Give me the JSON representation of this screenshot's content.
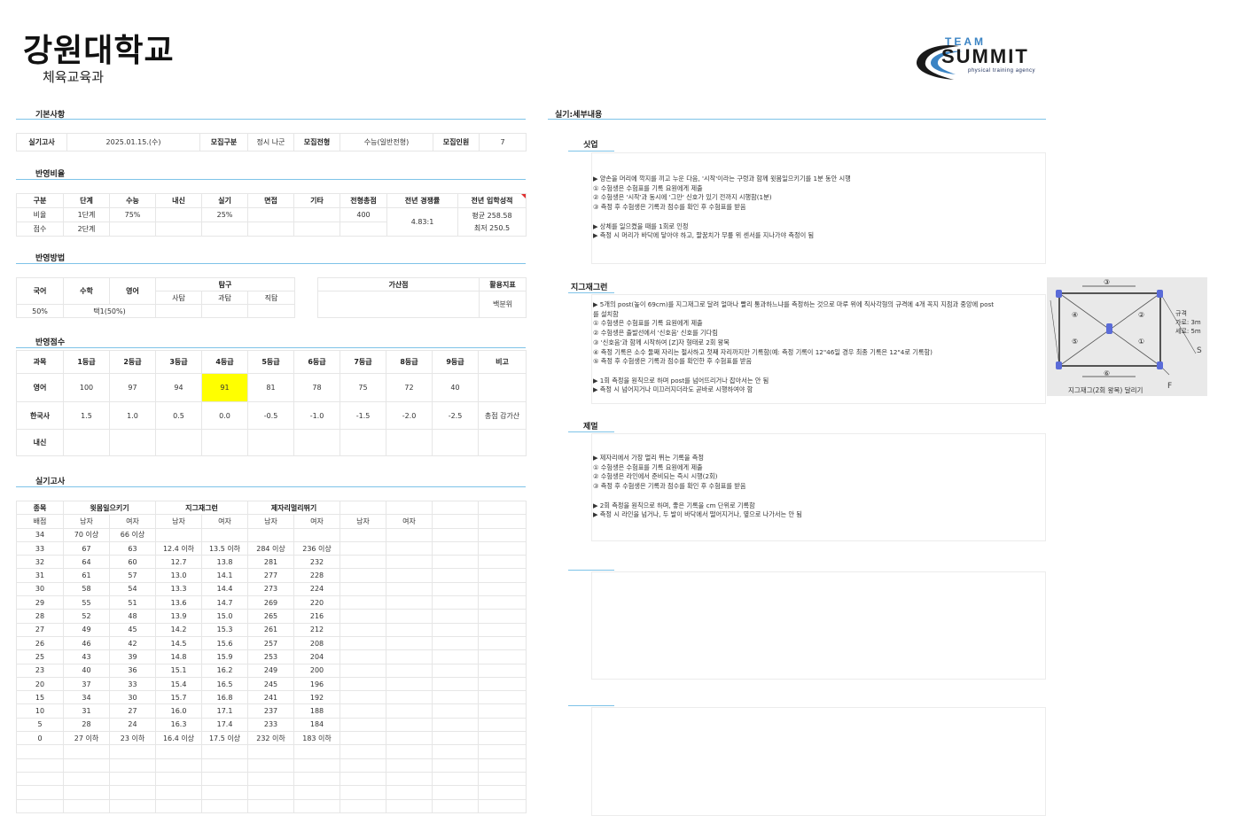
{
  "header": {
    "university": "강원대학교",
    "department": "체육교육과"
  },
  "logo": {
    "team": "TEAM",
    "summit": "SUMMIT",
    "tagline": "physical training agency"
  },
  "sections": {
    "basic": "기본사항",
    "ratio": "반영비율",
    "method": "반영방법",
    "score": "반영점수",
    "practical": "실기고사",
    "practical_detail": "실기:세부내용"
  },
  "basic": {
    "exam_label": "실기고사",
    "exam_date": "2025.01.15.(수)",
    "group_label": "모집구분",
    "group_value": "정시 나군",
    "type_label": "모집전형",
    "type_value": "수능(일반전형)",
    "quota_label": "모집인원",
    "quota_value": "7"
  },
  "ratio": {
    "headers": [
      "구분",
      "단계",
      "수능",
      "내신",
      "실기",
      "면접",
      "기타",
      "전형총점",
      "전년 경쟁률",
      "전년 입학성적"
    ],
    "row1": [
      "비율",
      "1단계",
      "75%",
      "",
      "25%",
      "",
      "",
      "400"
    ],
    "row2": [
      "점수",
      "2단계",
      "",
      "",
      "",
      "",
      "",
      ""
    ],
    "competition": "4.83:1",
    "admission_avg": "평균 258.58",
    "admission_min": "최저 250.5"
  },
  "method": {
    "korean": "국어",
    "math": "수학",
    "english": "영어",
    "inquiry": "탐구",
    "society": "사탐",
    "science": "과탐",
    "vocational": "직탐",
    "korean_value": "50%",
    "choice_value": "택1(50%)",
    "bonus": "가산점",
    "index": "활용지표",
    "index_value": "백분위"
  },
  "score": {
    "headers": [
      "과목",
      "1등급",
      "2등급",
      "3등급",
      "4등급",
      "5등급",
      "6등급",
      "7등급",
      "8등급",
      "9등급",
      "비고"
    ],
    "english": [
      "영어",
      "100",
      "97",
      "94",
      "91",
      "81",
      "78",
      "75",
      "72",
      "40",
      ""
    ],
    "history": [
      "한국사",
      "1.5",
      "1.0",
      "0.5",
      "0.0",
      "-0.5",
      "-1.0",
      "-1.5",
      "-2.0",
      "-2.5",
      "총점 감가산"
    ],
    "naesin": [
      "내신",
      "",
      "",
      "",
      "",
      "",
      "",
      "",
      "",
      "",
      ""
    ],
    "highlight_color": "#ffff00"
  },
  "practical": {
    "h1": [
      "종목",
      "윗몸일으키기",
      "지그재그런",
      "제자리멀리뛰기"
    ],
    "h2": [
      "배점",
      "남자",
      "여자",
      "남자",
      "여자",
      "남자",
      "여자",
      "남자",
      "여자"
    ],
    "rows": [
      [
        "34",
        "70 이상",
        "66 이상",
        "",
        "",
        "",
        ""
      ],
      [
        "33",
        "67",
        "63",
        "12.4 이하",
        "13.5 이하",
        "284 이상",
        "236 이상"
      ],
      [
        "32",
        "64",
        "60",
        "12.7",
        "13.8",
        "281",
        "232"
      ],
      [
        "31",
        "61",
        "57",
        "13.0",
        "14.1",
        "277",
        "228"
      ],
      [
        "30",
        "58",
        "54",
        "13.3",
        "14.4",
        "273",
        "224"
      ],
      [
        "29",
        "55",
        "51",
        "13.6",
        "14.7",
        "269",
        "220"
      ],
      [
        "28",
        "52",
        "48",
        "13.9",
        "15.0",
        "265",
        "216"
      ],
      [
        "27",
        "49",
        "45",
        "14.2",
        "15.3",
        "261",
        "212"
      ],
      [
        "26",
        "46",
        "42",
        "14.5",
        "15.6",
        "257",
        "208"
      ],
      [
        "25",
        "43",
        "39",
        "14.8",
        "15.9",
        "253",
        "204"
      ],
      [
        "23",
        "40",
        "36",
        "15.1",
        "16.2",
        "249",
        "200"
      ],
      [
        "20",
        "37",
        "33",
        "15.4",
        "16.5",
        "245",
        "196"
      ],
      [
        "15",
        "34",
        "30",
        "15.7",
        "16.8",
        "241",
        "192"
      ],
      [
        "10",
        "31",
        "27",
        "16.0",
        "17.1",
        "237",
        "188"
      ],
      [
        "5",
        "28",
        "24",
        "16.3",
        "17.4",
        "233",
        "184"
      ],
      [
        "0",
        "27 이하",
        "23 이하",
        "16.4 이상",
        "17.5 이상",
        "232 이하",
        "183 이하"
      ]
    ]
  },
  "details": {
    "situp": {
      "title": "싯업",
      "text": "▶ 양손을 머리에 깍지를 끼고 누운 다음, '시작'이라는 구령과 함께 윗몸일으키기를 1분 동안 시행\n① 수험생은 수험표를 기록 요원에게 제출\n② 수험생은 '시작'과 동시에 '그만' 신호가 있기 전까지 시행함(1분)\n③ 측정 후 수험생은 기록과 점수를 확인 후 수험표를 받음\n\n▶ 상체를 일으켰을 때를 1회로 인정\n▶ 측정 시 머리가 바닥에 닿아야 하고, 팔꿈치가 무릎 위 센서를 지나가야 측정이 됨"
    },
    "zigzag": {
      "title": "지그재그런",
      "text": "▶ 5개의 post(높이 69cm)를 지그재그로 달려 얼마나 빨리 통과하느냐를 측정하는 것으로 마루 위에 직사각형의 규격에 4개 꼭지 지점과 중앙에 post\n를 설치함\n① 수험생은 수험표를 기록 요원에게 제출\n② 수험생은 출발선에서 '신호음' 신호를 기다림\n③ '신호음'과 함께 시작하여 [Z]자 형태로 2회 왕복\n④ 측정 기록은 소수 둘째 자리는 절사하고 첫째 자리까지만 기록함(예: 측정 기록이 12\"46일 경우 최종 기록은 12\"4로 기록함)\n⑤ 측정 후 수험생은 기록과 점수를 확인한 후 수험표를 받음\n\n▶ 1회 측정을 원칙으로 하며 post를 넘어뜨리거나 잡아서는 안 됨\n▶ 측정 시 넘어지거나 미끄러지더라도 곧바로 시행하여야 함",
      "diagram_caption": "지그재그(2회 왕복) 달리기",
      "size_label": "규격",
      "width_label": "가로: 3m",
      "height_label": "세로: 5m",
      "start_label": "S",
      "finish_label": "F",
      "steps": [
        "①",
        "②",
        "③",
        "④",
        "⑤",
        "⑥"
      ]
    },
    "jump": {
      "title": "제멀",
      "text": "▶ 제자리에서 가장 멀리 뛰는 기록을 측정\n① 수험생은 수험표를 기록 요원에게 제출\n② 수험생은 라인에서 준비되는 즉시 시행(2회)\n③ 측정 후 수험생은 기록과 점수를 확인 후 수험표를 받음\n\n▶ 2회 측정을 원칙으로 하며, 좋은 기록을 cm 단위로 기록함\n▶ 측정 시 라인을 넘거나, 두 발이 바닥에서 떨어지거나, 옆으로 나가서는 안 됨"
    }
  }
}
